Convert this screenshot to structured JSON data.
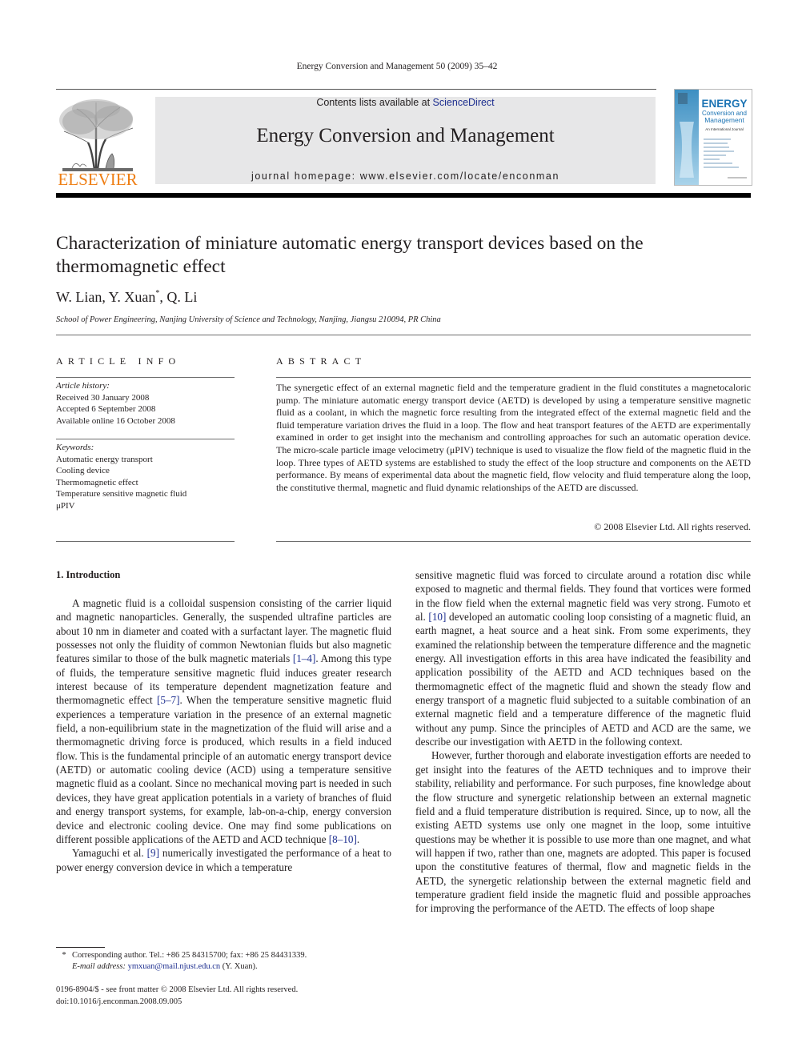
{
  "running_header": "Energy Conversion and Management 50 (2009) 35–42",
  "masthead": {
    "publisher_logo": "ELSEVIER",
    "contents_prefix": "Contents lists available at ",
    "contents_link": "ScienceDirect",
    "journal_title": "Energy Conversion and Management",
    "homepage": "journal homepage: www.elsevier.com/locate/enconman",
    "cover": {
      "title_line1": "ENERGY",
      "title_line2": "Conversion and",
      "title_line3": "Management",
      "subtitle": "An International Journal"
    },
    "colors": {
      "elsevier_orange": "#ee7d12",
      "link_blue": "#1d2e8f",
      "banner_grey": "#e7e7e8",
      "cover_blue": "#2a8bc4"
    }
  },
  "article": {
    "title": "Characterization of miniature automatic energy transport devices based on the thermomagnetic effect",
    "authors": {
      "a1": "W. Lian, ",
      "a2": "Y. Xuan",
      "a2_mark": "*",
      "a3": ", Q. Li"
    },
    "affiliation": "School of Power Engineering, Nanjing University of Science and Technology, Nanjing, Jiangsu 210094, PR China"
  },
  "article_info": {
    "heading": "ARTICLE INFO",
    "history_label": "Article history:",
    "history": [
      "Received 30 January 2008",
      "Accepted 6 September 2008",
      "Available online 16 October 2008"
    ],
    "keywords_label": "Keywords:",
    "keywords": [
      "Automatic energy transport",
      "Cooling device",
      "Thermomagnetic effect",
      "Temperature sensitive magnetic fluid",
      "μPIV"
    ]
  },
  "abstract": {
    "heading": "ABSTRACT",
    "text": "The synergetic effect of an external magnetic field and the temperature gradient in the fluid constitutes a magnetocaloric pump. The miniature automatic energy transport device (AETD) is developed by using a temperature sensitive magnetic fluid as a coolant, in which the magnetic force resulting from the integrated effect of the external magnetic field and the fluid temperature variation drives the fluid in a loop. The flow and heat transport features of the AETD are experimentally examined in order to get insight into the mechanism and controlling approaches for such an automatic operation device. The micro-scale particle image velocimetry (μPIV) technique is used to visualize the flow field of the magnetic fluid in the loop. Three types of AETD systems are established to study the effect of the loop structure and components on the AETD performance. By means of experimental data about the magnetic field, flow velocity and fluid temperature along the loop, the constitutive thermal, magnetic and fluid dynamic relationships of the AETD are discussed.",
    "copyright": "© 2008 Elsevier Ltd. All rights reserved."
  },
  "body": {
    "section1_heading": "1. Introduction",
    "p1": {
      "t1": "A magnetic fluid is a colloidal suspension consisting of the carrier liquid and magnetic nanoparticles. Generally, the suspended ultrafine particles are about 10 nm in diameter and coated with a surfactant layer. The magnetic fluid possesses not only the fluidity of common Newtonian fluids but also magnetic features similar to those of the bulk magnetic materials ",
      "c1": "[1–4]",
      "t2": ". Among this type of fluids, the temperature sensitive magnetic fluid induces greater research interest because of its temperature dependent magnetization feature and thermomagnetic effect ",
      "c2": "[5–7]",
      "t3": ". When the temperature sensitive magnetic fluid experiences a temperature variation in the presence of an external magnetic field, a non-equilibrium state in the magnetization of the fluid will arise and a thermomagnetic driving force is produced, which results in a field induced flow. This is the fundamental principle of an automatic energy transport device (AETD) or automatic cooling device (ACD) using a temperature sensitive magnetic fluid as a coolant. Since no mechanical moving part is needed in such devices, they have great application potentials in a variety of branches of fluid and energy transport systems, for example, lab-on-a-chip, energy conversion device and electronic cooling device. One may find some publications on different possible applications of the AETD and ACD technique ",
      "c3": "[8–10]",
      "t4": "."
    },
    "p2": {
      "t1": "Yamaguchi et al. ",
      "c1": "[9]",
      "t2": " numerically investigated the performance of a heat to power energy conversion device in which a temperature sensitive magnetic fluid was forced to circulate around a rotation disc while exposed to magnetic and thermal fields. They found that vortices were formed in the flow field when the external magnetic field was very strong. Fumoto et al. ",
      "c2": "[10]",
      "t3": " developed an automatic cooling loop consisting of a magnetic fluid, an earth magnet, a heat source and a heat sink. From some experiments, they examined the relationship between the temperature difference and the magnetic energy. All investigation efforts in this area have indicated the feasibility and application possibility of the AETD and ACD techniques based on the thermomagnetic effect of the magnetic fluid and shown the steady flow and energy transport of a magnetic fluid subjected to a suitable combination of an external magnetic field and a temperature difference of the magnetic fluid without any pump. Since the principles of AETD and ACD are the same, we describe our investigation with AETD in the following context."
    },
    "p3": "However, further thorough and elaborate investigation efforts are needed to get insight into the features of the AETD techniques and to improve their stability, reliability and performance. For such purposes, fine knowledge about the flow structure and synergetic relationship between an external magnetic field and a fluid temperature distribution is required. Since, up to now, all the existing AETD systems use only one magnet in the loop, some intuitive questions may be whether it is possible to use more than one magnet, and what will happen if two, rather than one, magnets are adopted. This paper is focused upon the constitutive features of thermal, flow and magnetic fields in the AETD, the synergetic relationship between the external magnetic field and temperature gradient field inside the magnetic fluid and possible approaches for improving the performance of the AETD. The effects of loop shape"
  },
  "footnote": {
    "mark": "*",
    "line1": "Corresponding author. Tel.: +86 25 84315700; fax: +86 25 84431339.",
    "email_label": "E-mail address: ",
    "email": "ymxuan@mail.njust.edu.cn",
    "email_suffix": " (Y. Xuan)."
  },
  "front_matter": {
    "issn_line": "0196-8904/$ - see front matter © 2008 Elsevier Ltd. All rights reserved.",
    "doi": "doi:10.1016/j.enconman.2008.09.005"
  }
}
